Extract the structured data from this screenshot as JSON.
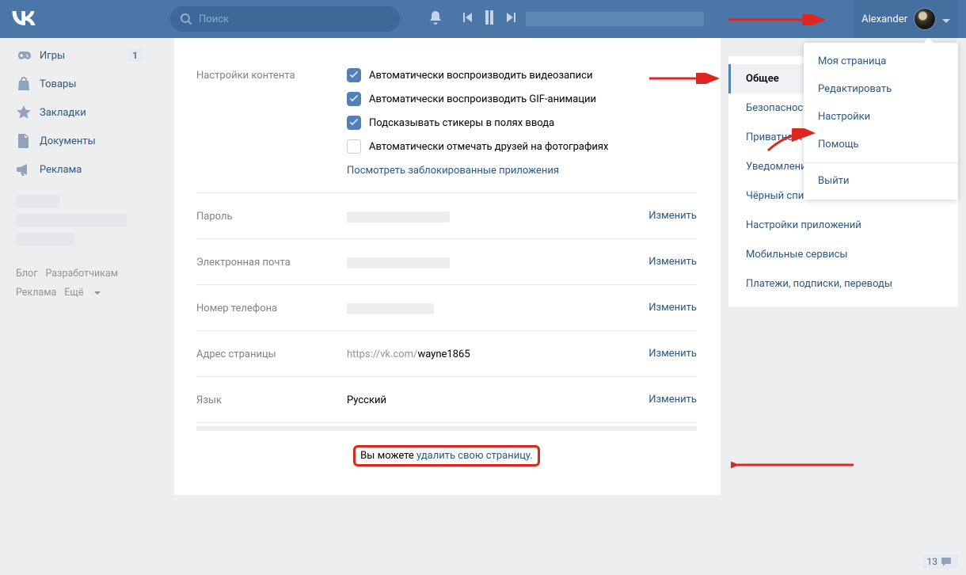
{
  "header": {
    "search_placeholder": "Поиск",
    "user_name": "Alexander"
  },
  "leftnav": {
    "items": [
      {
        "icon": "gamepad",
        "label": "Игры",
        "badge": "1"
      },
      {
        "icon": "bag",
        "label": "Товары"
      },
      {
        "icon": "star",
        "label": "Закладки"
      },
      {
        "icon": "doc",
        "label": "Документы"
      },
      {
        "icon": "megaphone",
        "label": "Реклама"
      }
    ]
  },
  "footer": {
    "blog": "Блог",
    "devs": "Разработчикам",
    "ads": "Реклама",
    "more": "Ещё"
  },
  "content": {
    "label": "Настройки контента",
    "checks": [
      {
        "checked": true,
        "text": "Автоматически воспроизводить видеозаписи"
      },
      {
        "checked": true,
        "text": "Автоматически воспроизводить GIF-анимации"
      },
      {
        "checked": true,
        "text": "Подсказывать стикеры в полях ввода"
      },
      {
        "checked": false,
        "text": "Автоматически отмечать друзей на фотографиях"
      }
    ],
    "blocked_link": "Посмотреть заблокированные приложения"
  },
  "rows": {
    "password_label": "Пароль",
    "email_label": "Электронная почта",
    "phone_label": "Номер телефона",
    "addr_label": "Адрес страницы",
    "addr_prefix": "https://vk.com/",
    "addr_value": "wayne1865",
    "lang_label": "Язык",
    "lang_value": "Русский",
    "change": "Изменить"
  },
  "delete": {
    "prefix": "Вы можете ",
    "link": "удалить свою страницу."
  },
  "tabs": [
    {
      "label": "Общее",
      "active": true
    },
    {
      "label": "Безопасность"
    },
    {
      "label": "Приватность"
    },
    {
      "label": "Уведомления"
    },
    {
      "label": "Чёрный список"
    },
    {
      "label": "Настройки приложений"
    },
    {
      "label": "Мобильные сервисы"
    },
    {
      "label": "Платежи, подписки, переводы"
    }
  ],
  "dropdown": [
    {
      "label": "Моя страница"
    },
    {
      "label": "Редактировать"
    },
    {
      "label": "Настройки"
    },
    {
      "label": "Помощь"
    },
    {
      "sep": true
    },
    {
      "label": "Выйти"
    }
  ],
  "chat_count": "13"
}
